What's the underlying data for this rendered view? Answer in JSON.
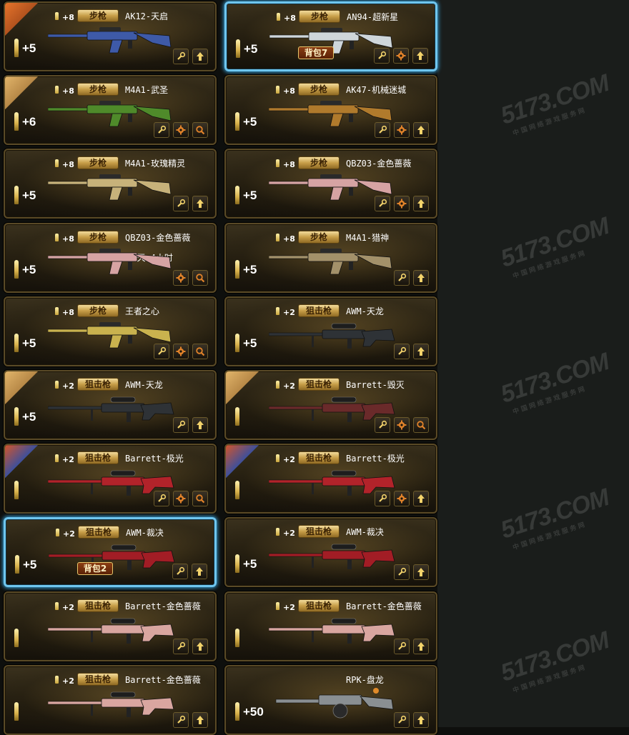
{
  "watermark": {
    "logo": "5173.COM",
    "tagline": "中国网络游戏服务网"
  },
  "items": [
    {
      "bonus": "+8",
      "type": "步枪",
      "name": "AK12-天启",
      "ammo": "+5",
      "corner": "orange",
      "buttons": [
        "wrench",
        "arrow"
      ],
      "selected": false,
      "pack": "",
      "extra": "",
      "gun": "rifle",
      "gunColor": "#3e5aa8"
    },
    {
      "bonus": "+8",
      "type": "步枪",
      "name": "AN94-超新星",
      "ammo": "+5",
      "corner": "",
      "buttons": [
        "wrench",
        "gear",
        "arrow"
      ],
      "selected": true,
      "pack": "背包7",
      "extra": "",
      "gun": "rifle",
      "gunColor": "#cfd6da"
    },
    {
      "bonus": "+8",
      "type": "步枪",
      "name": "M4A1-武圣",
      "ammo": "+6",
      "corner": "gold",
      "buttons": [
        "wrench",
        "gear",
        "search"
      ],
      "selected": false,
      "pack": "",
      "extra": "",
      "gun": "rifle",
      "gunColor": "#4f8a2a"
    },
    {
      "bonus": "+8",
      "type": "步枪",
      "name": "AK47-机械迷城",
      "ammo": "+5",
      "corner": "",
      "buttons": [
        "wrench",
        "gear",
        "arrow"
      ],
      "selected": false,
      "pack": "",
      "extra": "",
      "gun": "rifle",
      "gunColor": "#b07a2c"
    },
    {
      "bonus": "+8",
      "type": "步枪",
      "name": "M4A1-玫瑰精灵",
      "ammo": "+5",
      "corner": "",
      "buttons": [
        "wrench",
        "arrow"
      ],
      "selected": false,
      "pack": "",
      "extra": "",
      "gun": "rifle",
      "gunColor": "#c7b27a"
    },
    {
      "bonus": "+8",
      "type": "步枪",
      "name": "QBZ03-金色蔷薇",
      "ammo": "+5",
      "corner": "",
      "buttons": [
        "wrench",
        "gear",
        "arrow"
      ],
      "selected": false,
      "pack": "",
      "extra": "",
      "gun": "rifle",
      "gunColor": "#d6a3a3"
    },
    {
      "bonus": "+8",
      "type": "步枪",
      "name": "QBZ03-金色蔷薇",
      "ammo": "+5",
      "corner": "",
      "buttons": [
        "gear",
        "search"
      ],
      "selected": false,
      "pack": "",
      "extra": "10天 4小时",
      "gun": "rifle",
      "gunColor": "#d6a3a3"
    },
    {
      "bonus": "+8",
      "type": "步枪",
      "name": "M4A1-猎神",
      "ammo": "+5",
      "corner": "",
      "buttons": [
        "wrench",
        "arrow"
      ],
      "selected": false,
      "pack": "",
      "extra": "",
      "gun": "rifle",
      "gunColor": "#a3916a"
    },
    {
      "bonus": "+8",
      "type": "步枪",
      "name": "王者之心",
      "ammo": "+5",
      "corner": "",
      "buttons": [
        "wrench",
        "gear",
        "search"
      ],
      "selected": false,
      "pack": "",
      "extra": "",
      "gun": "rifle",
      "gunColor": "#c9b24e"
    },
    {
      "bonus": "+2",
      "type": "狙击枪",
      "name": "AWM-天龙",
      "ammo": "+5",
      "corner": "",
      "buttons": [
        "wrench",
        "arrow"
      ],
      "selected": false,
      "pack": "",
      "extra": "",
      "gun": "sniper",
      "gunColor": "#2e3236"
    },
    {
      "bonus": "+2",
      "type": "狙击枪",
      "name": "AWM-天龙",
      "ammo": "+5",
      "corner": "gold",
      "buttons": [
        "wrench",
        "arrow"
      ],
      "selected": false,
      "pack": "",
      "extra": "",
      "gun": "sniper",
      "gunColor": "#2e3236"
    },
    {
      "bonus": "+2",
      "type": "狙击枪",
      "name": "Barrett-毁灭",
      "ammo": "",
      "corner": "gold",
      "buttons": [
        "wrench",
        "gear",
        "search"
      ],
      "selected": false,
      "pack": "",
      "extra": "",
      "gun": "sniper",
      "gunColor": "#6a2a2a"
    },
    {
      "bonus": "+2",
      "type": "狙击枪",
      "name": "Barrett-极光",
      "ammo": "",
      "corner": "blue",
      "buttons": [
        "wrench",
        "gear",
        "search"
      ],
      "selected": false,
      "pack": "",
      "extra": "",
      "gun": "sniper",
      "gunColor": "#b2232a"
    },
    {
      "bonus": "+2",
      "type": "狙击枪",
      "name": "Barrett-极光",
      "ammo": "",
      "corner": "blue",
      "buttons": [
        "wrench",
        "gear",
        "arrow"
      ],
      "selected": false,
      "pack": "",
      "extra": "",
      "gun": "sniper",
      "gunColor": "#b2232a"
    },
    {
      "bonus": "+2",
      "type": "狙击枪",
      "name": "AWM-裁决",
      "ammo": "+5",
      "corner": "",
      "buttons": [
        "wrench",
        "arrow"
      ],
      "selected": true,
      "pack": "背包2",
      "extra": "",
      "gun": "sniper",
      "gunColor": "#a21d25"
    },
    {
      "bonus": "+2",
      "type": "狙击枪",
      "name": "AWM-裁决",
      "ammo": "+5",
      "corner": "",
      "buttons": [
        "wrench",
        "arrow"
      ],
      "selected": false,
      "pack": "",
      "extra": "",
      "gun": "sniper",
      "gunColor": "#a21d25"
    },
    {
      "bonus": "+2",
      "type": "狙击枪",
      "name": "Barrett-金色蔷薇",
      "ammo": "",
      "corner": "",
      "buttons": [
        "wrench",
        "arrow"
      ],
      "selected": false,
      "pack": "",
      "extra": "",
      "gun": "sniper",
      "gunColor": "#d9a6a0"
    },
    {
      "bonus": "+2",
      "type": "狙击枪",
      "name": "Barrett-金色蔷薇",
      "ammo": "",
      "corner": "",
      "buttons": [
        "wrench",
        "arrow"
      ],
      "selected": false,
      "pack": "",
      "extra": "",
      "gun": "sniper",
      "gunColor": "#d9a6a0"
    },
    {
      "bonus": "+2",
      "type": "狙击枪",
      "name": "Barrett-金色蔷薇",
      "ammo": "",
      "corner": "",
      "buttons": [
        "wrench",
        "arrow"
      ],
      "selected": false,
      "pack": "",
      "extra": "",
      "gun": "sniper",
      "gunColor": "#d9a6a0"
    },
    {
      "bonus": "",
      "type": "",
      "name": "RPK-盘龙",
      "ammo": "+50",
      "corner": "",
      "buttons": [
        "wrench",
        "arrow"
      ],
      "selected": false,
      "pack": "",
      "extra": "",
      "gun": "mg",
      "gunColor": "#8a8f92"
    }
  ]
}
